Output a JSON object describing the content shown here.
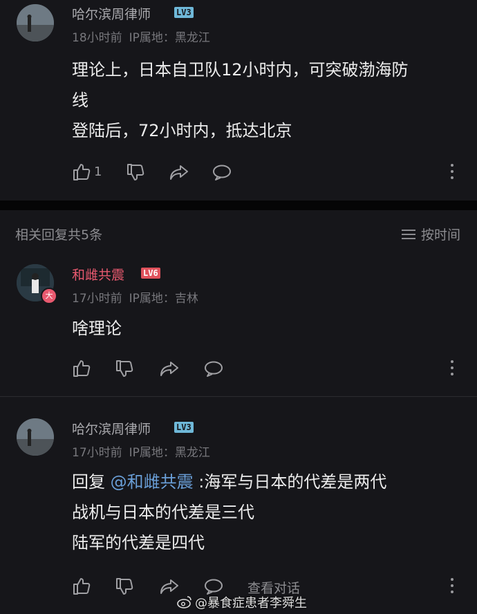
{
  "main_comment": {
    "username": "哈尔滨周律师",
    "level": "LV3",
    "time": "18小时前",
    "ip": "IP属地：黑龙江",
    "lines": [
      "理论上，日本自卫队12小时内，可突破渤海防",
      "线",
      "登陆后，72小时内，抵达北京"
    ],
    "like_count": "1"
  },
  "replies_header": {
    "count_label": "相关回复共5条",
    "sort_label": "按时间"
  },
  "reply1": {
    "username": "和雌共震",
    "level": "LV6",
    "badge": "大",
    "time": "17小时前",
    "ip": "IP属地：吉林",
    "lines": [
      "啥理论"
    ]
  },
  "reply2": {
    "username": "哈尔滨周律师",
    "level": "LV3",
    "time": "17小时前",
    "ip": "IP属地：黑龙江",
    "reply_prefix": "回复",
    "mention": "@和雌共震",
    "first_line_rest": ":海军与日本的代差是两代",
    "lines": [
      "战机与日本的代差是三代",
      "陆军的代差是四代"
    ],
    "view_conversation": "查看对话"
  },
  "watermark": "@暴食症患者李舜生",
  "colors": {
    "background": "#16161a",
    "username_gray": "#a9a9ad",
    "username_pink": "#e8596f",
    "mention_blue": "#6a9fd8",
    "level_blue": "#6fb8d8",
    "level_red": "#e0525c"
  },
  "icons": [
    "thumbs-up-icon",
    "thumbs-down-icon",
    "share-arrow-icon",
    "comment-bubble-icon",
    "more-vertical-icon",
    "sort-lines-icon",
    "weibo-icon"
  ]
}
